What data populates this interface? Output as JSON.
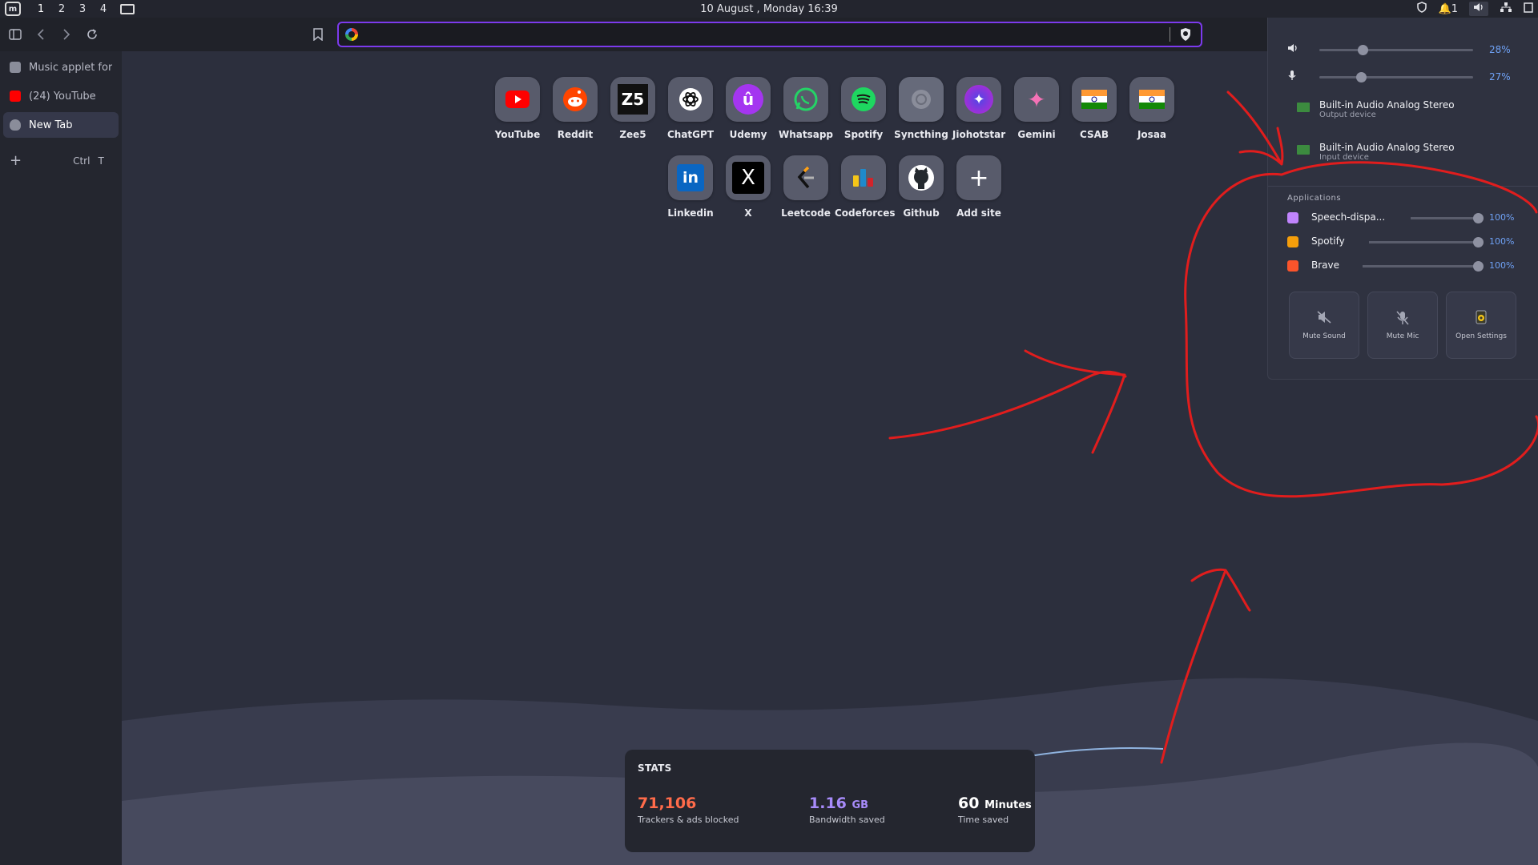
{
  "system_panel": {
    "workspaces": [
      "1",
      "2",
      "3",
      "4"
    ],
    "clock": "10 August , Monday   16:39",
    "notif_count": "1"
  },
  "browser": {
    "sidebar_tabs": [
      {
        "label": "Music applet for",
        "color": "#8a8d9a"
      },
      {
        "label": "(24) YouTube",
        "color": "#ff0000"
      },
      {
        "label": "New Tab",
        "color": "#8a8d9a"
      }
    ],
    "new_tab": {
      "plus": "+",
      "shortcut_ctrl": "Ctrl",
      "shortcut_key": "T"
    },
    "address_bar": {
      "value": "",
      "placeholder": ""
    },
    "accent": "#7c3aed"
  },
  "top_sites": [
    {
      "label": "YouTube",
      "icon": "youtube-icon"
    },
    {
      "label": "Reddit",
      "icon": "reddit-icon"
    },
    {
      "label": "Zee5",
      "icon": "zee5-icon",
      "glyph": "Z5"
    },
    {
      "label": "ChatGPT",
      "icon": "chatgpt-icon"
    },
    {
      "label": "Udemy",
      "icon": "udemy-icon",
      "glyph": "û"
    },
    {
      "label": "Whatsapp",
      "icon": "whatsapp-icon"
    },
    {
      "label": "Spotify",
      "icon": "spotify-icon"
    },
    {
      "label": "Syncthing",
      "icon": "syncthing-icon"
    },
    {
      "label": "Jiohotstar",
      "icon": "jiohotstar-icon",
      "glyph": "✦"
    },
    {
      "label": "Gemini",
      "icon": "gemini-icon",
      "glyph": "✦"
    },
    {
      "label": "CSAB",
      "icon": "india-flag-icon"
    },
    {
      "label": "Josaa",
      "icon": "india-flag-icon"
    },
    {
      "label": "Linkedin",
      "icon": "linkedin-icon",
      "glyph": "in"
    },
    {
      "label": "X",
      "icon": "x-icon",
      "glyph": "X"
    },
    {
      "label": "Leetcode",
      "icon": "leetcode-icon"
    },
    {
      "label": "Codeforces",
      "icon": "codeforces-icon"
    },
    {
      "label": "Github",
      "icon": "github-icon"
    },
    {
      "label": "Add site",
      "icon": "plus-icon",
      "glyph": "+"
    }
  ],
  "stats": {
    "title": "STATS",
    "trackers": {
      "value": "71,106",
      "label": "Trackers & ads blocked",
      "color": "#ff6b4a"
    },
    "bandwidth": {
      "value": "1.16",
      "unit": "GB",
      "label": "Bandwidth saved",
      "color": "#a78bfa"
    },
    "time": {
      "value": "60",
      "unit": "Minutes",
      "label": "Time saved",
      "color": "#ffffff"
    }
  },
  "sound_applet": {
    "output_volume": {
      "percent_label": "28%",
      "level": 0.28
    },
    "input_volume": {
      "percent_label": "27%",
      "level": 0.27
    },
    "output_device": {
      "name": "Built-in Audio Analog Stereo",
      "type": "Output device"
    },
    "input_device": {
      "name": "Built-in Audio Analog Stereo",
      "type": "Input device"
    },
    "applications_title": "Applications",
    "applications": [
      {
        "name": "Speech-dispa...",
        "percent_label": "100%",
        "level": 1.0,
        "color": "#c084fc"
      },
      {
        "name": "Spotify",
        "percent_label": "100%",
        "level": 1.0,
        "color": "#f59e0b"
      },
      {
        "name": "Brave",
        "percent_label": "100%",
        "level": 1.0,
        "color": "#fb542b"
      }
    ],
    "quick_buttons": [
      {
        "label": "Mute Sound",
        "icon": "mute-sound-icon"
      },
      {
        "label": "Mute Mic",
        "icon": "mute-mic-icon"
      },
      {
        "label": "Open Settings",
        "icon": "speaker-settings-icon"
      }
    ],
    "accent": "#6fa2f6"
  }
}
